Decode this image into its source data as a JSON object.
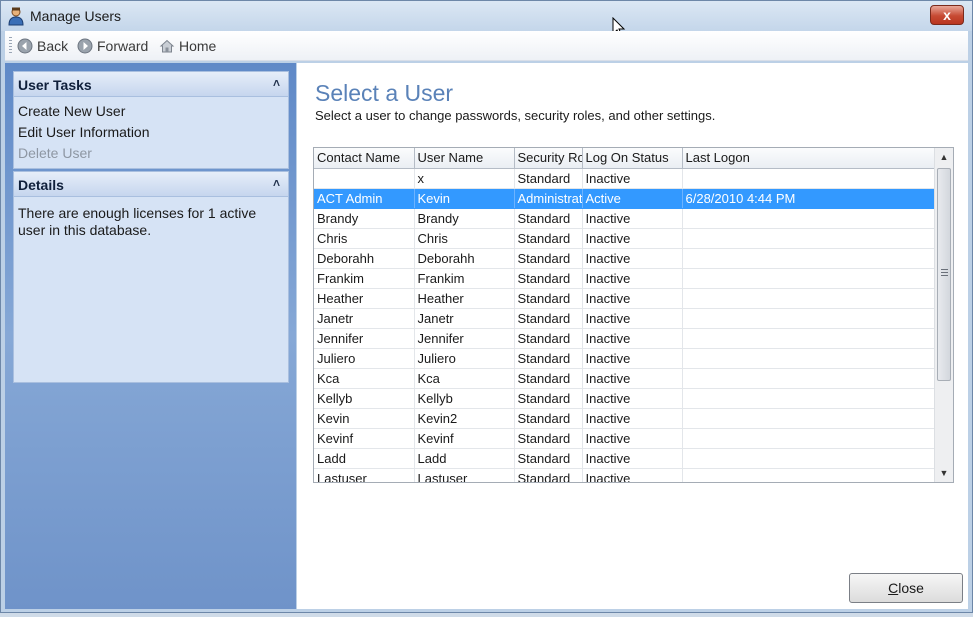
{
  "window": {
    "title": "Manage Users",
    "close_glyph": "x"
  },
  "toolbar": {
    "back_label": "Back",
    "forward_label": "Forward",
    "home_label": "Home"
  },
  "sidebar": {
    "user_tasks": {
      "title": "User Tasks",
      "items": [
        {
          "label": "Create New User",
          "enabled": true
        },
        {
          "label": "Edit User Information",
          "enabled": true
        },
        {
          "label": "Delete User",
          "enabled": false
        }
      ]
    },
    "details": {
      "title": "Details",
      "text": "There are enough licenses for 1 active user in this database."
    }
  },
  "main": {
    "heading": "Select a User",
    "subheading": "Select a user to change passwords, security roles, and other settings.",
    "columns": [
      "Contact Name",
      "User Name",
      "Security Role",
      "Log On Status",
      "Last Logon"
    ],
    "rows": [
      [
        "",
        "x",
        "Standard",
        "Inactive",
        ""
      ],
      [
        "ACT Admin",
        "Kevin",
        "Administrator",
        "Active",
        "6/28/2010 4:44 PM"
      ],
      [
        "Brandy",
        "Brandy",
        "Standard",
        "Inactive",
        ""
      ],
      [
        "Chris",
        "Chris",
        "Standard",
        "Inactive",
        ""
      ],
      [
        "Deborahh",
        "Deborahh",
        "Standard",
        "Inactive",
        ""
      ],
      [
        "Frankim",
        "Frankim",
        "Standard",
        "Inactive",
        ""
      ],
      [
        "Heather",
        "Heather",
        "Standard",
        "Inactive",
        ""
      ],
      [
        "Janetr",
        "Janetr",
        "Standard",
        "Inactive",
        ""
      ],
      [
        "Jennifer",
        "Jennifer",
        "Standard",
        "Inactive",
        ""
      ],
      [
        "Juliero",
        "Juliero",
        "Standard",
        "Inactive",
        ""
      ],
      [
        "Kca",
        "Kca",
        "Standard",
        "Inactive",
        ""
      ],
      [
        "Kellyb",
        "Kellyb",
        "Standard",
        "Inactive",
        ""
      ],
      [
        "Kevin",
        "Kevin2",
        "Standard",
        "Inactive",
        ""
      ],
      [
        "Kevinf",
        "Kevinf",
        "Standard",
        "Inactive",
        ""
      ],
      [
        "Ladd",
        "Ladd",
        "Standard",
        "Inactive",
        ""
      ],
      [
        "Lastuser",
        "Lastuser",
        "Standard",
        "Inactive",
        ""
      ]
    ],
    "selected_row": 1,
    "close_label_accel": "C",
    "close_label_rest": "lose"
  },
  "colors": {
    "selection": "#3399ff",
    "heading": "#5a82b8",
    "sidebar": "#6f93c9"
  },
  "icons": {
    "app": "users-icon",
    "back": "back-arrow-icon",
    "forward": "forward-arrow-icon",
    "home": "home-icon",
    "collapse": "chevron-double-up-icon"
  }
}
